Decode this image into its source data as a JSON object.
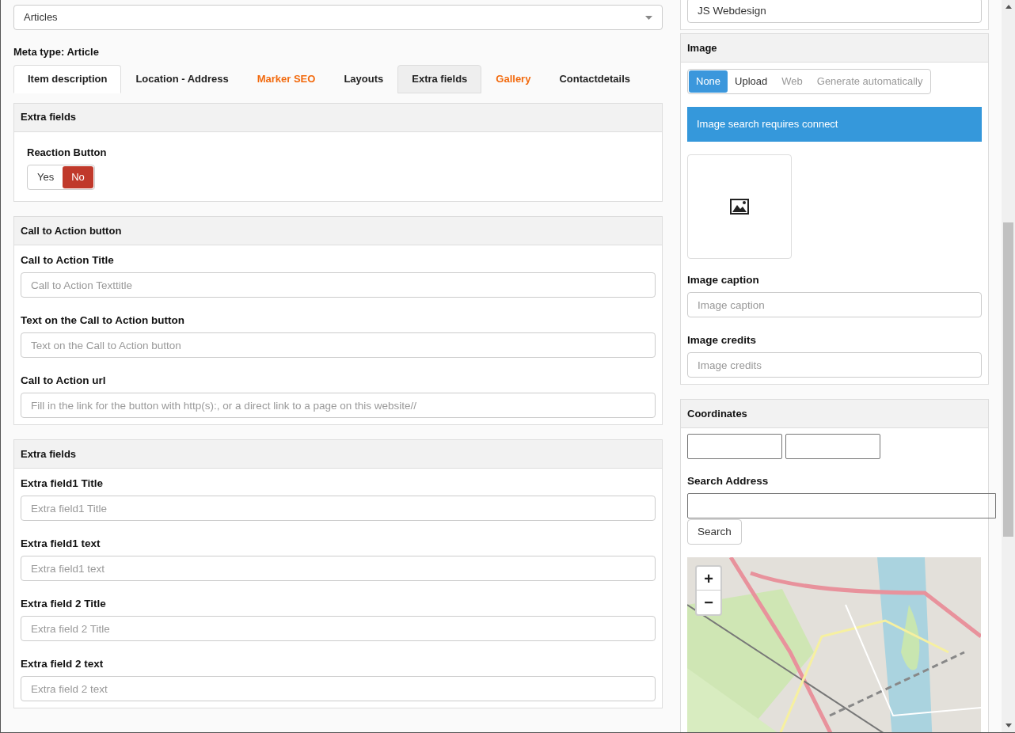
{
  "category_select": {
    "value": "Articles"
  },
  "meta_type": "Meta type: Article",
  "tabs": [
    {
      "label": "Item description",
      "selected": true,
      "hovered": false,
      "color": "#222222"
    },
    {
      "label": "Location - Address",
      "selected": false,
      "hovered": false,
      "color": "#222222"
    },
    {
      "label": "Marker SEO",
      "selected": false,
      "hovered": false,
      "color": "#f26a0e"
    },
    {
      "label": "Layouts",
      "selected": false,
      "hovered": false,
      "color": "#222222"
    },
    {
      "label": "Extra fields",
      "selected": false,
      "hovered": true,
      "color": "#222222"
    },
    {
      "label": "Gallery",
      "selected": false,
      "hovered": false,
      "color": "#f26a0e"
    },
    {
      "label": "Contactdetails",
      "selected": false,
      "hovered": false,
      "color": "#222222"
    }
  ],
  "panels": [
    {
      "title": "Extra fields",
      "kind": "toggle",
      "label": "Reaction Button",
      "options": [
        {
          "label": "Yes",
          "selected": false
        },
        {
          "label": "No",
          "selected": true
        }
      ]
    },
    {
      "title": "Call to Action button",
      "kind": "fields",
      "fields": [
        {
          "label": "Call to Action Title",
          "placeholder": "Call to Action Texttitle"
        },
        {
          "label": "Text on the Call to Action button",
          "placeholder": "Text on the Call to Action button"
        },
        {
          "label": "Call to Action url",
          "placeholder": "Fill in the link for the button with http(s):, or a direct link to a page on this website//"
        }
      ]
    },
    {
      "title": "Extra fields",
      "kind": "fields",
      "fields": [
        {
          "label": "Extra field1 Title",
          "placeholder": "Extra field1 Title"
        },
        {
          "label": "Extra field1 text",
          "placeholder": "Extra field1 text"
        },
        {
          "label": "Extra field 2 Title",
          "placeholder": "Extra field 2 Title"
        },
        {
          "label": "Extra field 2 text",
          "placeholder": "Extra field 2 text"
        }
      ]
    }
  ],
  "author_field": {
    "value": "JS Webdesign"
  },
  "image_panel": {
    "title": "Image",
    "sources": [
      {
        "label": "None",
        "selected": true,
        "disabled": false
      },
      {
        "label": "Upload",
        "selected": false,
        "disabled": false
      },
      {
        "label": "Web",
        "selected": false,
        "disabled": true
      },
      {
        "label": "Generate automatically",
        "selected": false,
        "disabled": true
      }
    ],
    "notice": "Image search requires connect",
    "fields": [
      {
        "label": "Image caption",
        "placeholder": "Image caption"
      },
      {
        "label": "Image credits",
        "placeholder": "Image credits"
      }
    ]
  },
  "coordinates_panel": {
    "title": "Coordinates",
    "search_label": "Search Address",
    "search_button": "Search",
    "zoom_in": "+",
    "zoom_out": "−"
  }
}
